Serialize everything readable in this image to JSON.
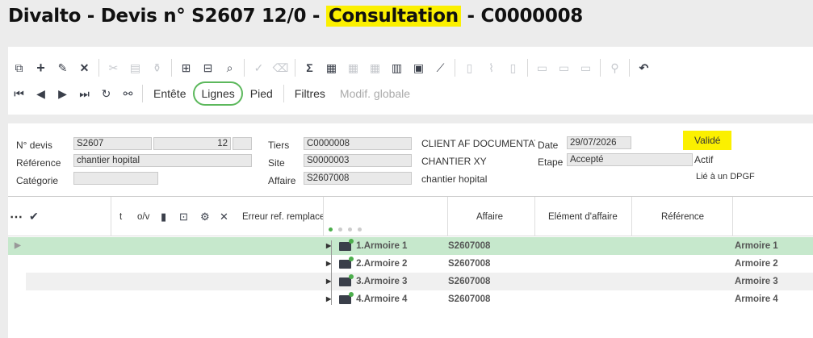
{
  "title": {
    "prefix": "Divalto - Devis n° S2607 12/0 - ",
    "mode": "Consultation",
    "suffix": " - C0000008"
  },
  "toolbar": {
    "tabs": {
      "entete": "Entête",
      "lignes": "Lignes",
      "pied": "Pied",
      "filtres": "Filtres",
      "modif_globale": "Modif. globale"
    }
  },
  "header": {
    "labels": {
      "ndevis": "N° devis",
      "reference": "Référence",
      "categorie": "Catégorie",
      "tiers": "Tiers",
      "site": "Site",
      "affaire": "Affaire",
      "date": "Date",
      "etape": "Etape"
    },
    "values": {
      "ndevis": "S2607",
      "ndevis_version": "12",
      "ndevis_extra": "",
      "reference": "chantier hopital",
      "categorie": "",
      "tiers": "C0000008",
      "tiers_name": "CLIENT AF  DOCUMENTATION",
      "site": "S0000003",
      "site_name": "CHANTIER XY",
      "affaire": "S2607008",
      "affaire_name": "chantier hopital",
      "date": "29/07/2026",
      "etape": "Accepté",
      "status": "Validé",
      "actif": "Actif",
      "lie": "Lié à un DPGF"
    }
  },
  "grid": {
    "headers": {
      "t": "t",
      "ov": "o/v",
      "erreur": "Erreur ref. remplacer",
      "affaire": "Affaire",
      "element": "Elément d'affaire",
      "reference": "Référence"
    },
    "rows": [
      {
        "designation": "1.Armoire 1",
        "affaire": "S2607008",
        "reference": "Armoire 1"
      },
      {
        "designation": "2.Armoire 2",
        "affaire": "S2607008",
        "reference": "Armoire 2"
      },
      {
        "designation": "3.Armoire 3",
        "affaire": "S2607008",
        "reference": "Armoire 3"
      },
      {
        "designation": "4.Armoire 4",
        "affaire": "S2607008",
        "reference": "Armoire 4"
      }
    ]
  },
  "colors": {
    "highlight": "#fbf000",
    "accent_green": "#5cb85c",
    "selected_row": "#c6e8cc"
  }
}
